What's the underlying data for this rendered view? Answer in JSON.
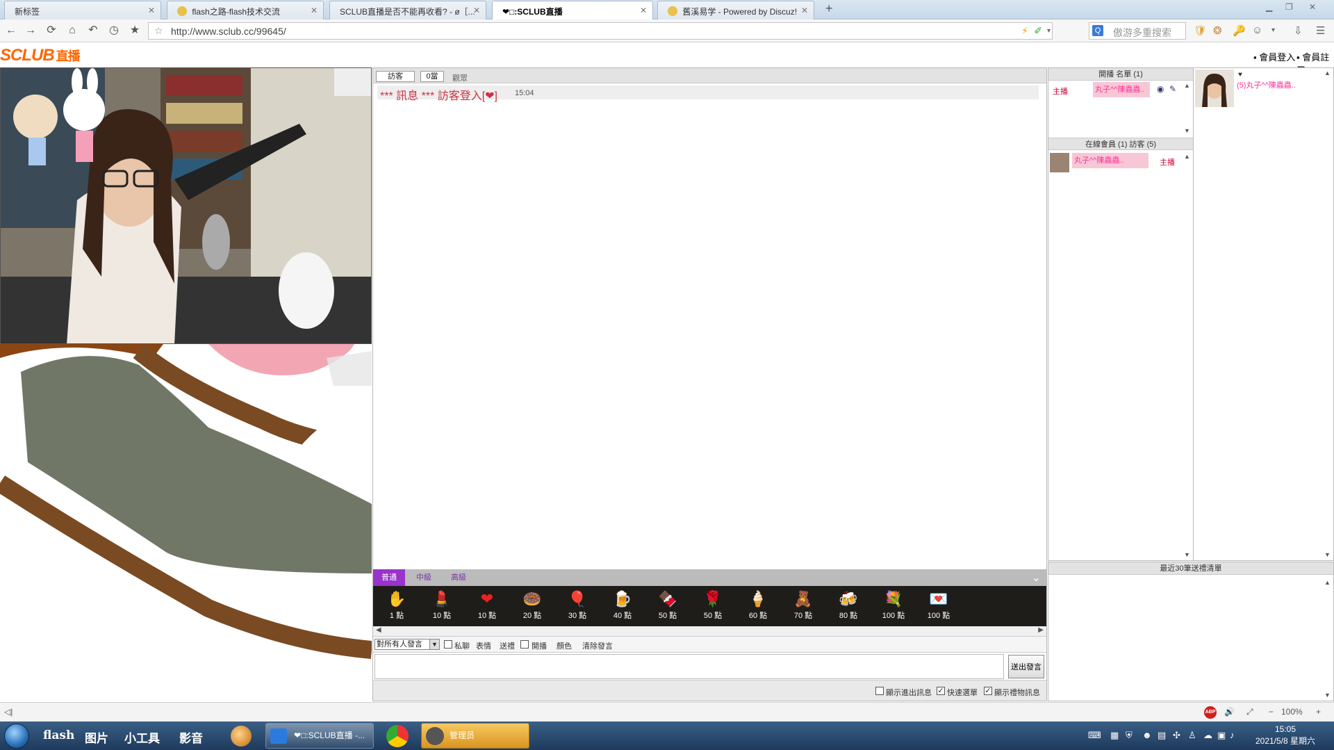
{
  "browser": {
    "tabs": [
      {
        "label": "新标签"
      },
      {
        "label": "flash之路-flash技术交流"
      },
      {
        "label": "SCLUB直播是否不能再收看? - ø［..."
      },
      {
        "label": "❤□:SCLUB直播"
      },
      {
        "label": "舊溪易学 - Powered by Discuz!"
      }
    ],
    "new_tab": "+",
    "url": "http://www.sclub.cc/99645/",
    "search_placeholder": "傲游多重搜索"
  },
  "site": {
    "logo_main": "SCLUB",
    "logo_sub": "直播",
    "login": "會員登入",
    "register": "會員註冊"
  },
  "chat": {
    "tab_guest": "訪客",
    "tab_count": "0當",
    "tab_watch": "觀眾",
    "message": "*** 訊息 *** 訪客登入[❤]",
    "message_time": "15:04",
    "gift_tabs": [
      "普通",
      "中級",
      "高級"
    ],
    "gifts": [
      {
        "icon": "✋",
        "points": "1 點"
      },
      {
        "icon": "💄",
        "points": "10 點"
      },
      {
        "icon": "❤",
        "points": "10 點"
      },
      {
        "icon": "🍩",
        "points": "20 點"
      },
      {
        "icon": "🎈",
        "points": "30 點"
      },
      {
        "icon": "🍺",
        "points": "40 點"
      },
      {
        "icon": "🍫",
        "points": "50 點"
      },
      {
        "icon": "🌹",
        "points": "50 點"
      },
      {
        "icon": "🍦",
        "points": "60 點"
      },
      {
        "icon": "🧸",
        "points": "70 點"
      },
      {
        "icon": "🍻",
        "points": "80 點"
      },
      {
        "icon": "💐",
        "points": "100 點"
      },
      {
        "icon": "💌",
        "points": "100 點"
      }
    ],
    "target_select": "對所有人發言",
    "private": "私聊",
    "emotion": "表情",
    "gift": "送禮",
    "open": "開播",
    "color": "顏色",
    "clear": "清除發言",
    "send": "送出發言",
    "show_leave": "顯示進出訊息",
    "quick_scroll": "快速選單",
    "show_gift": "顯示禮物訊息"
  },
  "side": {
    "host_header": "開播 名單 (1)",
    "host_role": "主播",
    "host_name": "丸子^^陳蟲蟲..",
    "online_header": "在線會員 (1) 訪客 (5)",
    "online_name": "丸子^^陳蟲蟲..",
    "online_role": "主播",
    "far_name": "(5)丸子^^陳蟲蟲..",
    "gift_list_header": "最近30筆送禮清單"
  },
  "status": {
    "zoom": "100%"
  },
  "taskbar": {
    "quicklinks": [
      "flash",
      "图片",
      "小工具",
      "影音"
    ],
    "app1": "❤□:SCLUB直播 -...",
    "app2": "管理员",
    "time": "15:05",
    "date": "2021/5/8 星期六"
  },
  "colors": {
    "gift_tab_active": "#9933cc",
    "host_name_bg": "#f7c7d5",
    "message": "#cc3344"
  }
}
